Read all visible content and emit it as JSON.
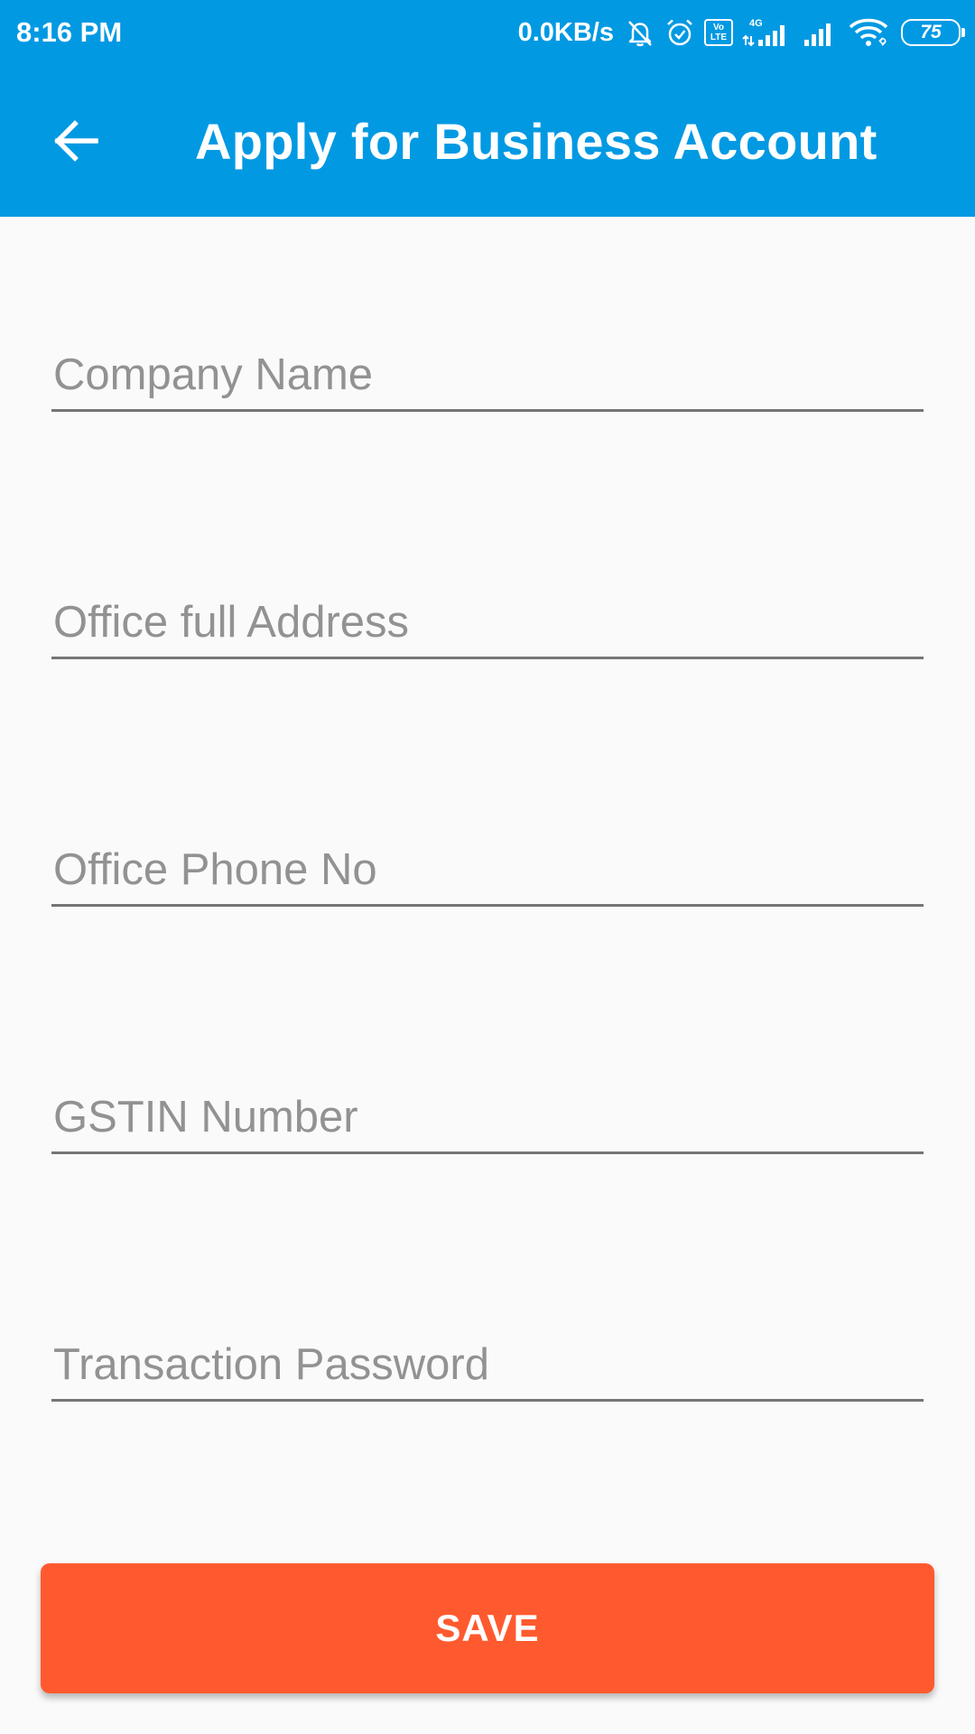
{
  "status_bar": {
    "time": "8:16 PM",
    "net_speed": "0.0KB/s",
    "volte_line1": "Vo",
    "volte_line2": "LTE",
    "network_type": "4G",
    "battery": "75",
    "icons": [
      "mute-bell-icon",
      "alarm-icon",
      "volte-icon",
      "signal-4g-icon",
      "signal-icon",
      "wifi-icon",
      "battery-icon"
    ]
  },
  "app_bar": {
    "title": "Apply for Business Account",
    "back_icon": "arrow-back-icon"
  },
  "form": {
    "fields": [
      {
        "placeholder": "Company Name",
        "value": ""
      },
      {
        "placeholder": "Office full Address",
        "value": ""
      },
      {
        "placeholder": "Office Phone No",
        "value": ""
      },
      {
        "placeholder": "GSTIN Number",
        "value": ""
      },
      {
        "placeholder": "Transaction Password",
        "value": ""
      }
    ]
  },
  "save_button": {
    "label": "SAVE"
  },
  "colors": {
    "primary": "#0299e3",
    "accent": "#ff5a2f",
    "background": "#fafafa",
    "underline": "#757575",
    "placeholder": "#929292"
  }
}
